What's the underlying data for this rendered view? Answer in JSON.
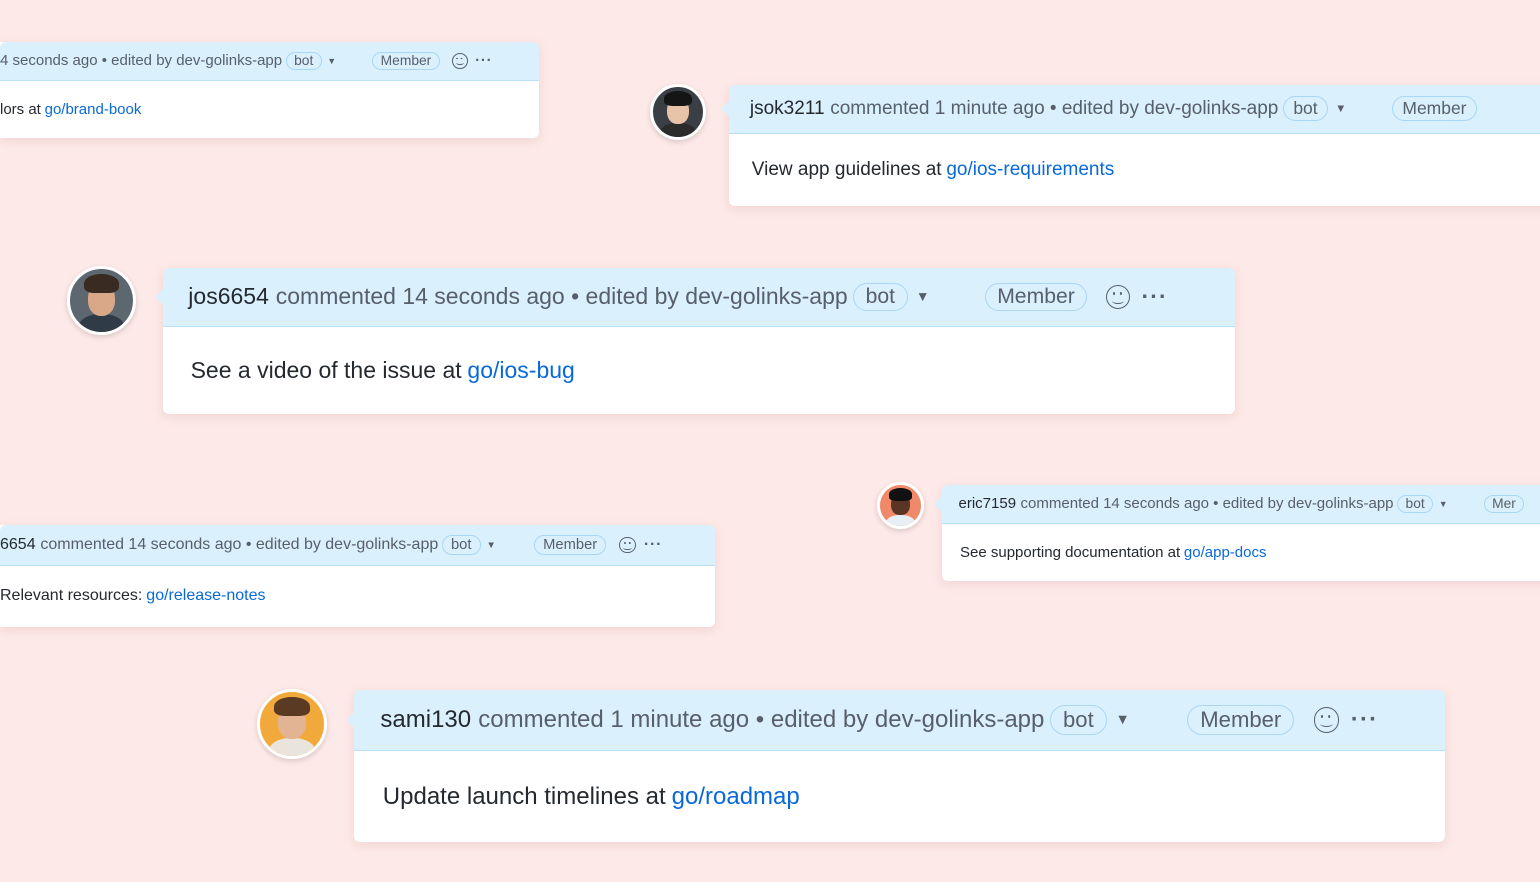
{
  "colors": {
    "background": "#fde9e7",
    "header": "#dbf0fd",
    "link": "#0969da",
    "text": "#24292f",
    "muted": "#57606a"
  },
  "comments": [
    {
      "user": "",
      "meta": "4 seconds ago • edited by dev-golinks-app",
      "bot": "bot",
      "member": "Member",
      "body": "lors at",
      "link": "go/brand-book",
      "avatar": null,
      "show_actions": true
    },
    {
      "user": "jsok3211",
      "meta": "commented 1 minute ago • edited by dev-golinks-app",
      "bot": "bot",
      "member": "Member",
      "body": "View app guidelines at",
      "link": "go/ios-requirements",
      "avatar": {
        "bg": "#3a3f45",
        "skin": "#e8c3a8",
        "hair": "#151515",
        "shirt": "#2b2b2b"
      },
      "show_actions": false
    },
    {
      "user": "jos6654",
      "meta": "commented 14 seconds ago • edited by dev-golinks-app",
      "bot": "bot",
      "member": "Member",
      "body": "See a video of the issue at",
      "link": "go/ios-bug",
      "avatar": {
        "bg": "#5d6770",
        "skin": "#d9a888",
        "hair": "#3a2b22",
        "shirt": "#2f3b47"
      },
      "show_actions": true
    },
    {
      "user": "6654",
      "meta": "commented 14 seconds ago • edited by dev-golinks-app",
      "bot": "bot",
      "member": "Member",
      "body": "Relevant resources:",
      "link": "go/release-notes",
      "avatar": null,
      "show_actions": true
    },
    {
      "user": "eric7159",
      "meta": "commented 14 seconds ago • edited by dev-golinks-app",
      "bot": "bot",
      "member": "Mer",
      "body": "See supporting documentation at",
      "link": "go/app-docs",
      "avatar": {
        "bg": "#f0896a",
        "skin": "#5a3524",
        "hair": "#111",
        "shirt": "#e8eef5"
      },
      "show_actions": false
    },
    {
      "user": "sami130",
      "meta": "commented 1 minute ago • edited by dev-golinks-app",
      "bot": "bot",
      "member": "Member",
      "body": "Update launch timelines at",
      "link": "go/roadmap",
      "avatar": {
        "bg": "#f2a93b",
        "skin": "#e2b493",
        "hair": "#5a3a22",
        "shirt": "#e9e4dc"
      },
      "show_actions": true
    }
  ]
}
